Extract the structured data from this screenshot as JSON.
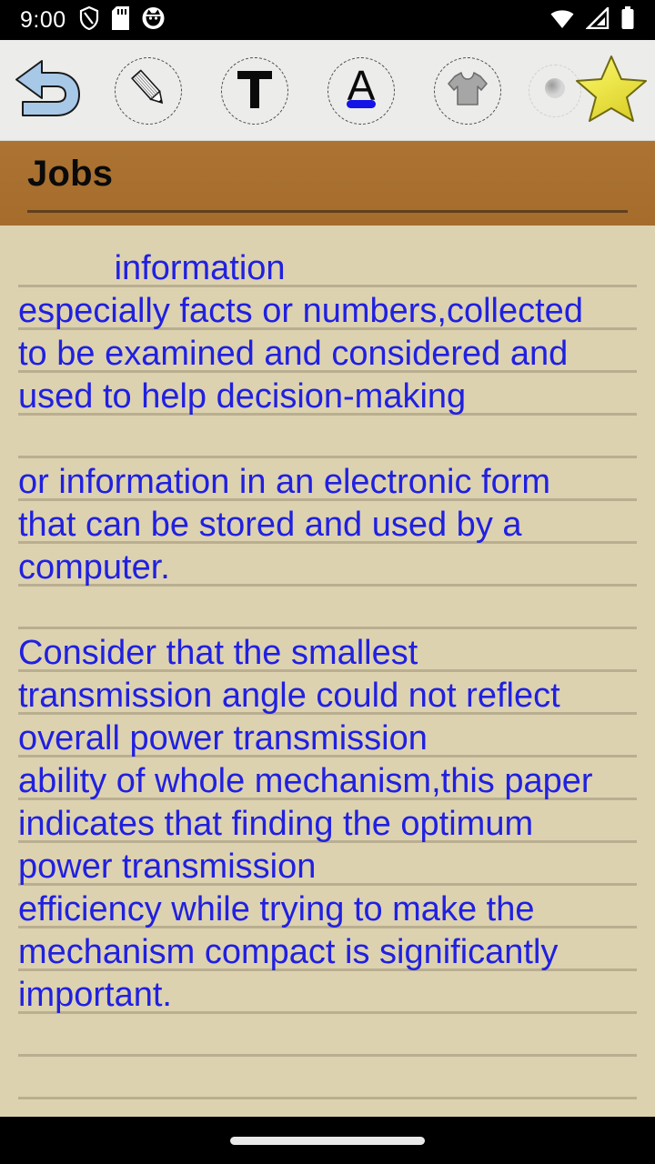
{
  "status_bar": {
    "time": "9:00",
    "left_icons": [
      "shield-icon",
      "sd-card-icon",
      "cat-face-icon"
    ],
    "right_icons": [
      "wifi-icon",
      "cell-signal-icon",
      "battery-icon"
    ]
  },
  "toolbar": {
    "background": "#ececeb",
    "items": [
      {
        "name": "undo-button",
        "icon": "undo-arrow-icon",
        "label": "Undo",
        "color": "#a8c8e8"
      },
      {
        "name": "draw-button",
        "icon": "pencil-icon",
        "label": "Draw"
      },
      {
        "name": "text-button",
        "icon": "text-t-icon",
        "label": "Text"
      },
      {
        "name": "font-style-button",
        "icon": "underlined-a-icon",
        "label": "Font style",
        "accent": "#1414e6"
      },
      {
        "name": "share-button",
        "icon": "tshirt-arrow-up-icon",
        "label": "Share"
      },
      {
        "name": "more-button",
        "icon": "dot-icon",
        "label": "More"
      },
      {
        "name": "favorite-button",
        "icon": "star-icon",
        "label": "Favorite",
        "color": "#e8e042"
      }
    ],
    "selection_bar_color": "#9a9a9a"
  },
  "note": {
    "title": "Jobs",
    "header_color": "#a9702f",
    "page_color": "#ddd2b0",
    "rule_color": "#b9ae90",
    "text_color": "#2020e0",
    "lines": [
      "          information",
      "especially facts or numbers,collected",
      "to be examined and considered and",
      "used to help decision-making",
      "",
      "or information in an electronic form",
      "that can be stored and used by a",
      "computer.",
      "",
      "Consider that the smallest",
      "transmission angle could not reflect",
      "overall power transmission",
      "ability of whole mechanism,this paper",
      "indicates that finding the optimum",
      "power transmission",
      "efficiency while trying to make the",
      "mechanism compact is significantly",
      "important.",
      "",
      "",
      ""
    ]
  },
  "navigation_bar": {
    "home_indicator": "home-pill"
  }
}
